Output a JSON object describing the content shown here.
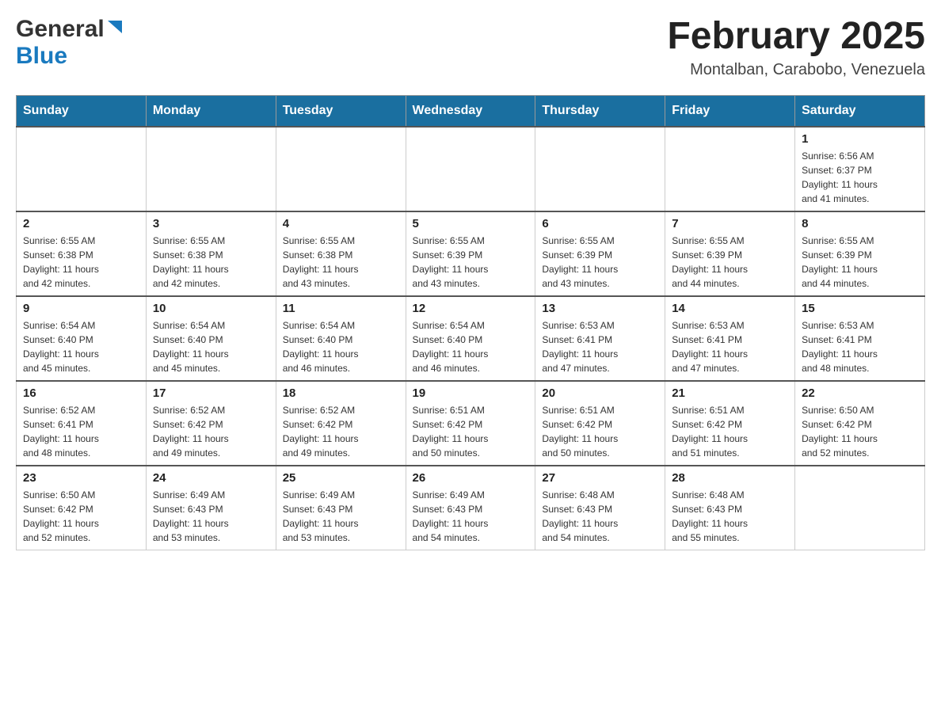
{
  "header": {
    "logo_general": "General",
    "logo_blue": "Blue",
    "month_title": "February 2025",
    "location": "Montalban, Carabobo, Venezuela"
  },
  "weekdays": [
    "Sunday",
    "Monday",
    "Tuesday",
    "Wednesday",
    "Thursday",
    "Friday",
    "Saturday"
  ],
  "weeks": [
    {
      "days": [
        {
          "number": "",
          "info": ""
        },
        {
          "number": "",
          "info": ""
        },
        {
          "number": "",
          "info": ""
        },
        {
          "number": "",
          "info": ""
        },
        {
          "number": "",
          "info": ""
        },
        {
          "number": "",
          "info": ""
        },
        {
          "number": "1",
          "info": "Sunrise: 6:56 AM\nSunset: 6:37 PM\nDaylight: 11 hours\nand 41 minutes."
        }
      ]
    },
    {
      "days": [
        {
          "number": "2",
          "info": "Sunrise: 6:55 AM\nSunset: 6:38 PM\nDaylight: 11 hours\nand 42 minutes."
        },
        {
          "number": "3",
          "info": "Sunrise: 6:55 AM\nSunset: 6:38 PM\nDaylight: 11 hours\nand 42 minutes."
        },
        {
          "number": "4",
          "info": "Sunrise: 6:55 AM\nSunset: 6:38 PM\nDaylight: 11 hours\nand 43 minutes."
        },
        {
          "number": "5",
          "info": "Sunrise: 6:55 AM\nSunset: 6:39 PM\nDaylight: 11 hours\nand 43 minutes."
        },
        {
          "number": "6",
          "info": "Sunrise: 6:55 AM\nSunset: 6:39 PM\nDaylight: 11 hours\nand 43 minutes."
        },
        {
          "number": "7",
          "info": "Sunrise: 6:55 AM\nSunset: 6:39 PM\nDaylight: 11 hours\nand 44 minutes."
        },
        {
          "number": "8",
          "info": "Sunrise: 6:55 AM\nSunset: 6:39 PM\nDaylight: 11 hours\nand 44 minutes."
        }
      ]
    },
    {
      "days": [
        {
          "number": "9",
          "info": "Sunrise: 6:54 AM\nSunset: 6:40 PM\nDaylight: 11 hours\nand 45 minutes."
        },
        {
          "number": "10",
          "info": "Sunrise: 6:54 AM\nSunset: 6:40 PM\nDaylight: 11 hours\nand 45 minutes."
        },
        {
          "number": "11",
          "info": "Sunrise: 6:54 AM\nSunset: 6:40 PM\nDaylight: 11 hours\nand 46 minutes."
        },
        {
          "number": "12",
          "info": "Sunrise: 6:54 AM\nSunset: 6:40 PM\nDaylight: 11 hours\nand 46 minutes."
        },
        {
          "number": "13",
          "info": "Sunrise: 6:53 AM\nSunset: 6:41 PM\nDaylight: 11 hours\nand 47 minutes."
        },
        {
          "number": "14",
          "info": "Sunrise: 6:53 AM\nSunset: 6:41 PM\nDaylight: 11 hours\nand 47 minutes."
        },
        {
          "number": "15",
          "info": "Sunrise: 6:53 AM\nSunset: 6:41 PM\nDaylight: 11 hours\nand 48 minutes."
        }
      ]
    },
    {
      "days": [
        {
          "number": "16",
          "info": "Sunrise: 6:52 AM\nSunset: 6:41 PM\nDaylight: 11 hours\nand 48 minutes."
        },
        {
          "number": "17",
          "info": "Sunrise: 6:52 AM\nSunset: 6:42 PM\nDaylight: 11 hours\nand 49 minutes."
        },
        {
          "number": "18",
          "info": "Sunrise: 6:52 AM\nSunset: 6:42 PM\nDaylight: 11 hours\nand 49 minutes."
        },
        {
          "number": "19",
          "info": "Sunrise: 6:51 AM\nSunset: 6:42 PM\nDaylight: 11 hours\nand 50 minutes."
        },
        {
          "number": "20",
          "info": "Sunrise: 6:51 AM\nSunset: 6:42 PM\nDaylight: 11 hours\nand 50 minutes."
        },
        {
          "number": "21",
          "info": "Sunrise: 6:51 AM\nSunset: 6:42 PM\nDaylight: 11 hours\nand 51 minutes."
        },
        {
          "number": "22",
          "info": "Sunrise: 6:50 AM\nSunset: 6:42 PM\nDaylight: 11 hours\nand 52 minutes."
        }
      ]
    },
    {
      "days": [
        {
          "number": "23",
          "info": "Sunrise: 6:50 AM\nSunset: 6:42 PM\nDaylight: 11 hours\nand 52 minutes."
        },
        {
          "number": "24",
          "info": "Sunrise: 6:49 AM\nSunset: 6:43 PM\nDaylight: 11 hours\nand 53 minutes."
        },
        {
          "number": "25",
          "info": "Sunrise: 6:49 AM\nSunset: 6:43 PM\nDaylight: 11 hours\nand 53 minutes."
        },
        {
          "number": "26",
          "info": "Sunrise: 6:49 AM\nSunset: 6:43 PM\nDaylight: 11 hours\nand 54 minutes."
        },
        {
          "number": "27",
          "info": "Sunrise: 6:48 AM\nSunset: 6:43 PM\nDaylight: 11 hours\nand 54 minutes."
        },
        {
          "number": "28",
          "info": "Sunrise: 6:48 AM\nSunset: 6:43 PM\nDaylight: 11 hours\nand 55 minutes."
        },
        {
          "number": "",
          "info": ""
        }
      ]
    }
  ]
}
